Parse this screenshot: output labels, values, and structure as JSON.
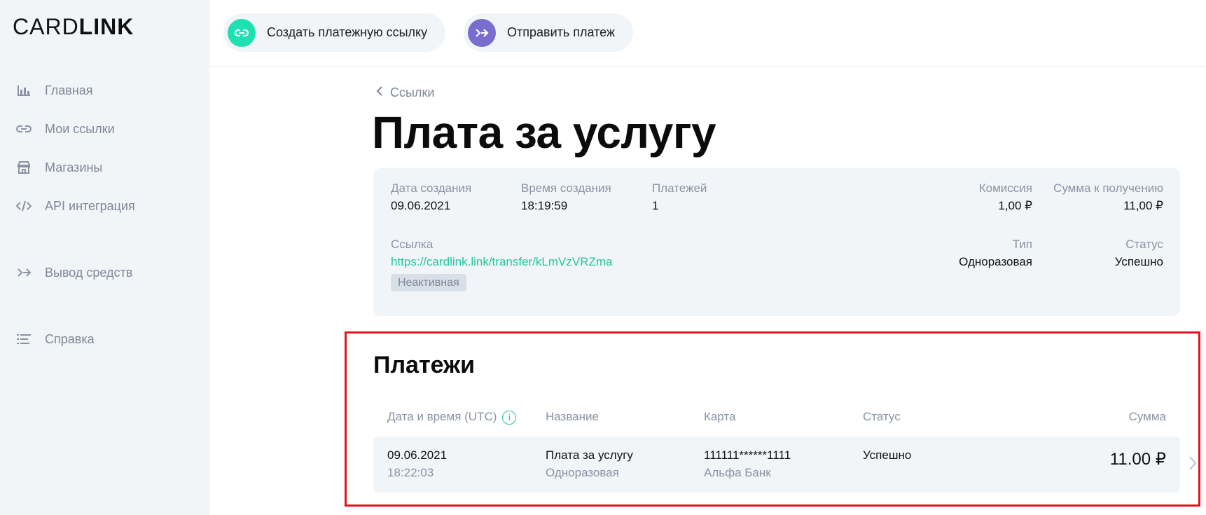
{
  "brand": {
    "logo_light": "CARD",
    "logo_bold": "LINK"
  },
  "sidebar": {
    "items": [
      {
        "label": "Главная",
        "icon": "bar-chart-icon"
      },
      {
        "label": "Мои ссылки",
        "icon": "link-icon"
      },
      {
        "label": "Магазины",
        "icon": "store-icon"
      },
      {
        "label": "API интеграция",
        "icon": "code-icon"
      },
      {
        "label": "Вывод средств",
        "icon": "double-arrow-icon"
      },
      {
        "label": "Справка",
        "icon": "list-icon"
      }
    ]
  },
  "topbar": {
    "create_link_label": "Создать платежную ссылку",
    "send_payment_label": "Отправить платеж"
  },
  "breadcrumb": {
    "back_label": "Ссылки"
  },
  "page": {
    "title": "Плата за услугу"
  },
  "details": {
    "created_date_label": "Дата создания",
    "created_date": "09.06.2021",
    "created_time_label": "Время создания",
    "created_time": "18:19:59",
    "payments_label": "Платежей",
    "payments_count": "1",
    "commission_label": "Комиссия",
    "commission": "1,00 ₽",
    "receive_label": "Сумма к получению",
    "receive_amount": "11,00 ₽",
    "link_label": "Ссылка",
    "link_url": "https://cardlink.link/transfer/kLmVzVRZma",
    "link_state": "Неактивная",
    "type_label": "Тип",
    "type_value": "Одноразовая",
    "status_label": "Статус",
    "status_value": "Успешно"
  },
  "payments": {
    "title": "Платежи",
    "columns": {
      "datetime": "Дата и время (UTC)",
      "name": "Название",
      "card": "Карта",
      "status": "Статус",
      "amount": "Сумма"
    },
    "rows": [
      {
        "date": "09.06.2021",
        "time": "18:22:03",
        "name": "Плата за услугу",
        "type": "Одноразовая",
        "card": "111111******1111",
        "bank": "Альфа Банк",
        "status": "Успешно",
        "amount": "11.00 ₽"
      }
    ]
  },
  "colors": {
    "accent_green": "#1fc7a0",
    "accent_purple": "#7b6ccf",
    "highlight_red": "#e0141f"
  }
}
